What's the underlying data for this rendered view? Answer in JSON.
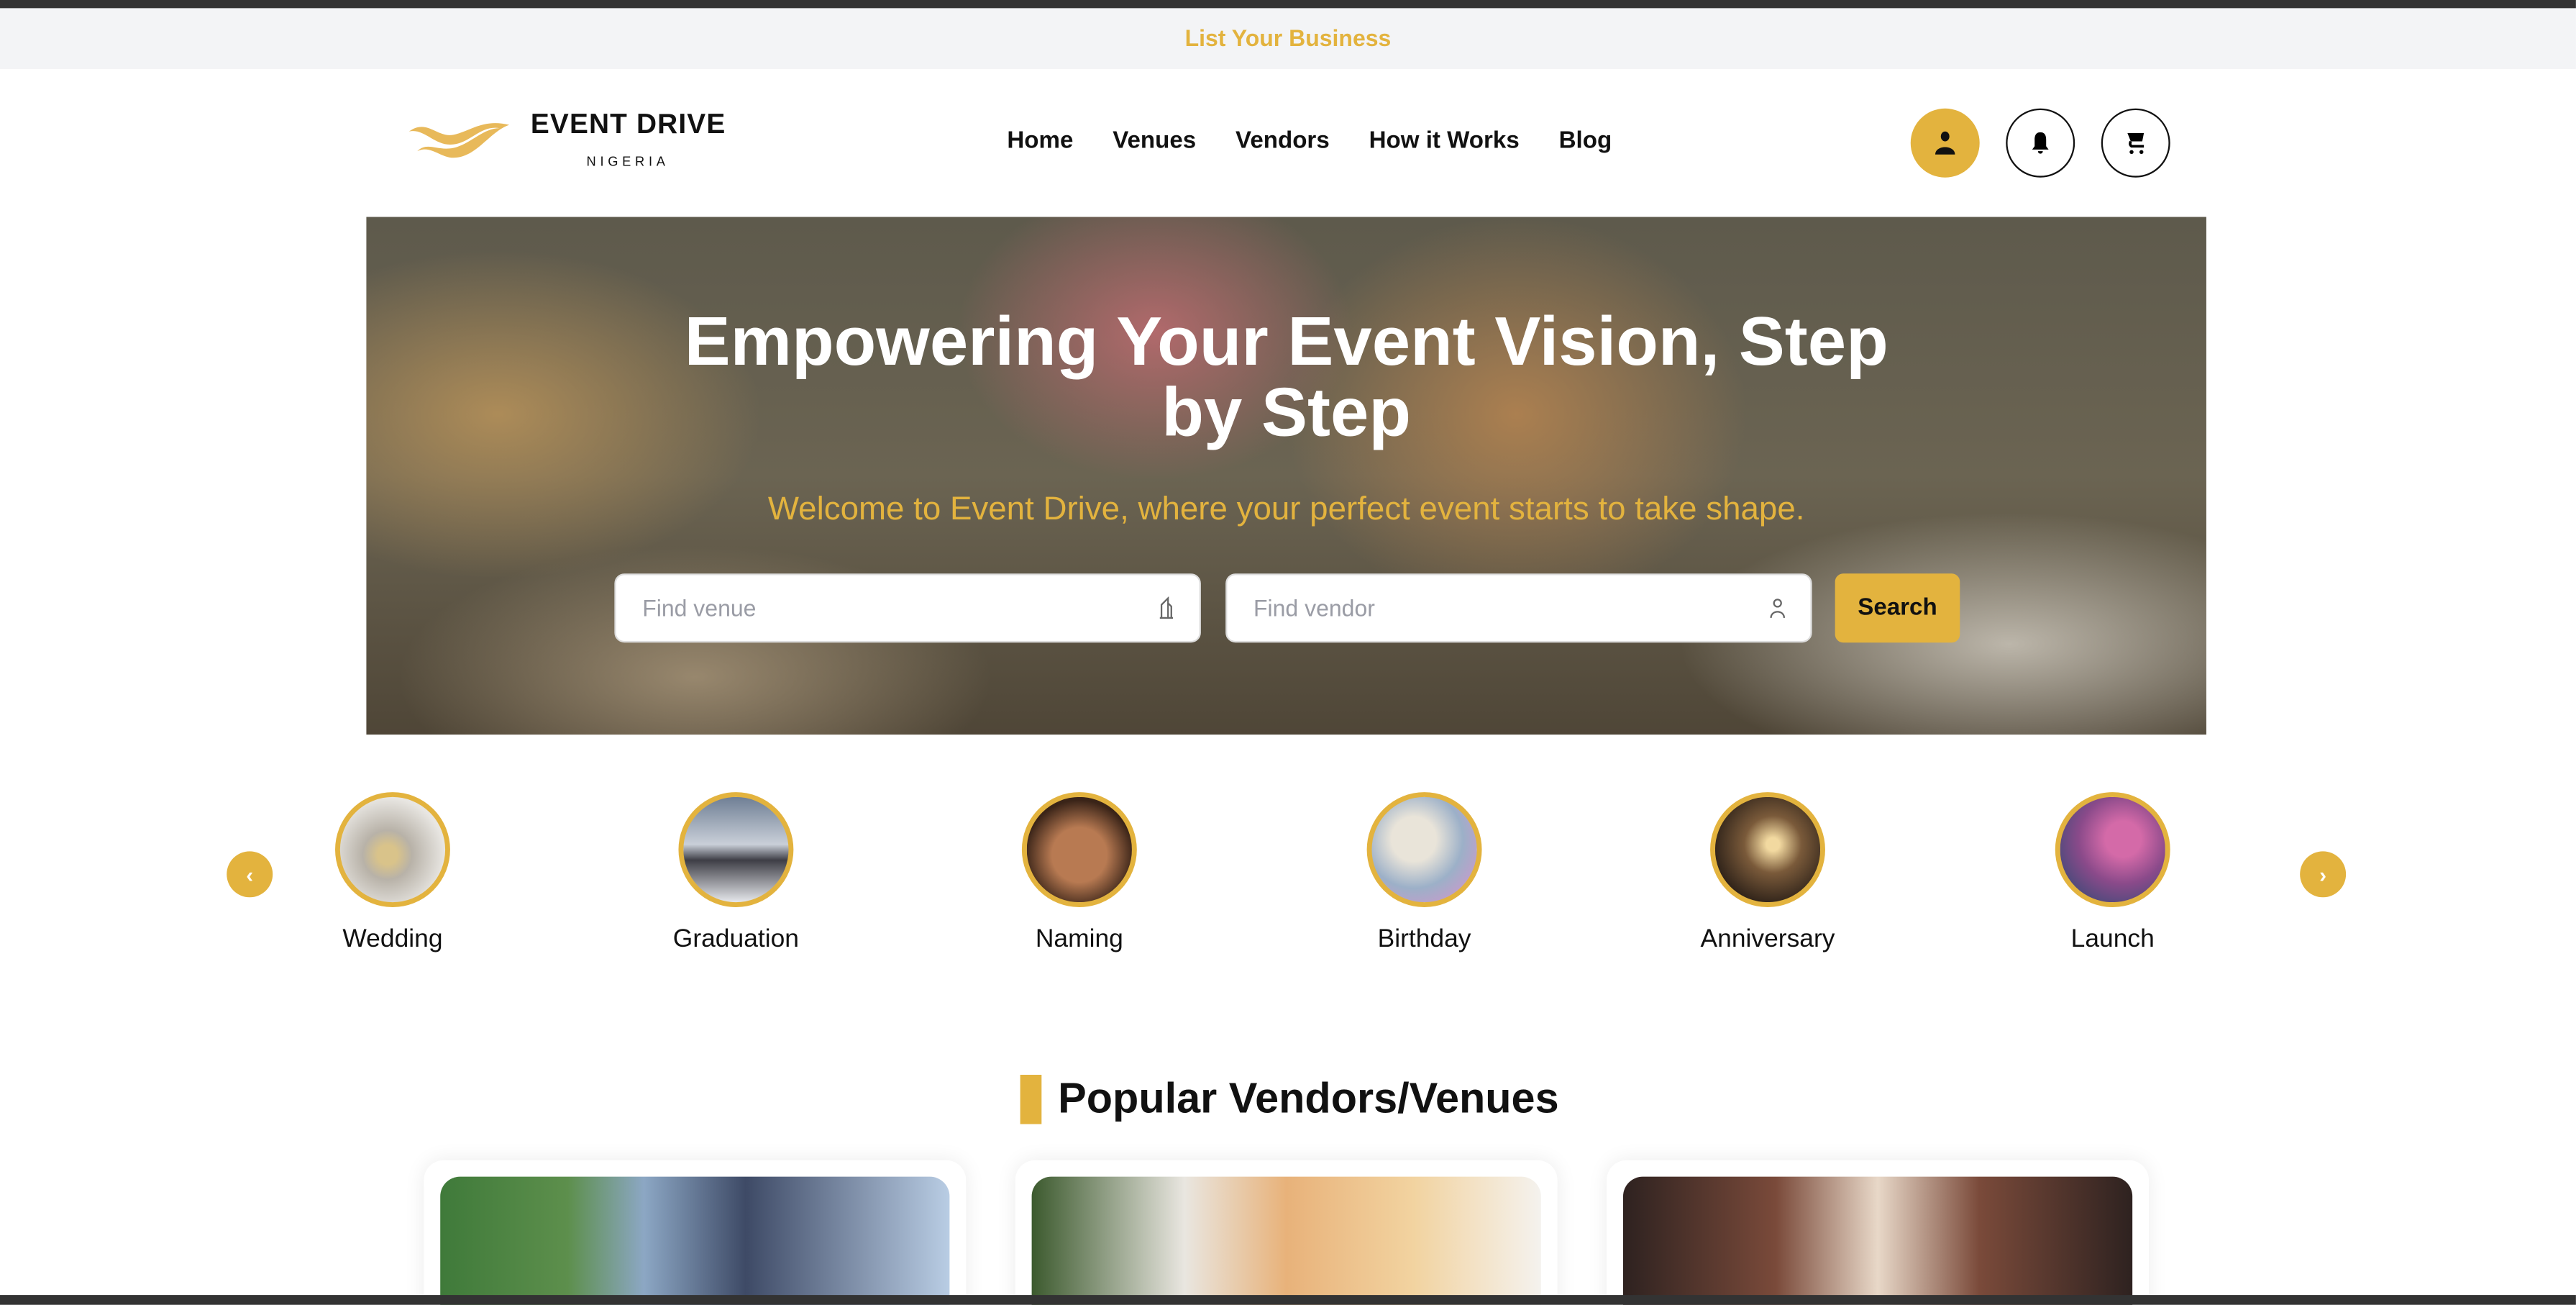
{
  "promo": {
    "label": "List Your Business"
  },
  "brand": {
    "name": "EVENT DRIVE",
    "sub": "NIGERIA",
    "accent": "#E3B33E"
  },
  "nav": {
    "items": [
      "Home",
      "Venues",
      "Vendors",
      "How it Works",
      "Blog"
    ]
  },
  "header_icons": [
    "user-icon",
    "bell-icon",
    "cart-icon"
  ],
  "hero": {
    "title": "Empowering Your Event Vision, Step by Step",
    "subtitle": "Welcome to Event Drive, where your perfect event starts to take shape.",
    "venue_placeholder": "Find venue",
    "vendor_placeholder": "Find vendor",
    "search_label": "Search"
  },
  "categories": [
    "Wedding",
    "Graduation",
    "Naming",
    "Birthday",
    "Anniversary",
    "Launch"
  ],
  "popular": {
    "title": "Popular Vendors/Venues"
  }
}
